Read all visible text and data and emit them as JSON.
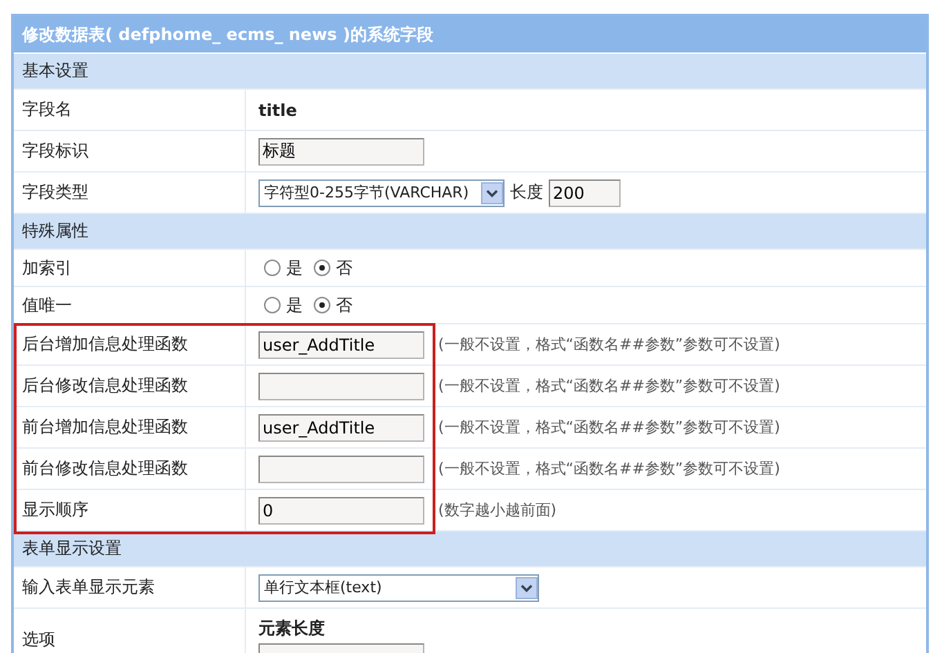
{
  "title": "修改数据表( defphome_ ecms_ news )的系统字段",
  "sections": [
    {
      "heading": "基本设置",
      "rows": [
        {
          "kind": "text",
          "label": "字段名",
          "value": "title"
        },
        {
          "kind": "input",
          "label": "字段标识",
          "value": "标题"
        },
        {
          "kind": "select",
          "label": "字段类型",
          "value": "字符型0-255字节(VARCHAR)",
          "extra_label": "长度",
          "extra_value": "200"
        }
      ]
    },
    {
      "heading": "特殊属性",
      "rows": [
        {
          "kind": "radio",
          "label": "加索引",
          "options": [
            {
              "label": "是",
              "selected": false
            },
            {
              "label": "否",
              "selected": true
            }
          ]
        },
        {
          "kind": "radio",
          "label": "值唯一",
          "options": [
            {
              "label": "是",
              "selected": false
            },
            {
              "label": "否",
              "selected": true
            }
          ]
        },
        {
          "kind": "input",
          "label": "后台增加信息处理函数",
          "value": "user_AddTitle",
          "hint": "(一般不设置，格式“函数名##参数”参数可不设置)",
          "highlighted": true
        },
        {
          "kind": "input",
          "label": "后台修改信息处理函数",
          "value": "",
          "hint": "(一般不设置，格式“函数名##参数”参数可不设置)",
          "highlighted": true
        },
        {
          "kind": "input",
          "label": "前台增加信息处理函数",
          "value": "user_AddTitle",
          "hint": "(一般不设置，格式“函数名##参数”参数可不设置)",
          "highlighted": true
        },
        {
          "kind": "input",
          "label": "前台修改信息处理函数",
          "value": "",
          "hint": "(一般不设置，格式“函数名##参数”参数可不设置)",
          "highlighted": true
        },
        {
          "kind": "input",
          "label": "显示顺序",
          "value": "0",
          "hint": "(数字越小越前面)",
          "highlighted": true
        }
      ]
    },
    {
      "heading": "表单显示设置",
      "rows": [
        {
          "kind": "select",
          "label": "输入表单显示元素",
          "value": "单行文本框(text)"
        },
        {
          "kind": "options",
          "label": "选项",
          "sub_label": "元素长度",
          "value": ""
        }
      ]
    }
  ]
}
